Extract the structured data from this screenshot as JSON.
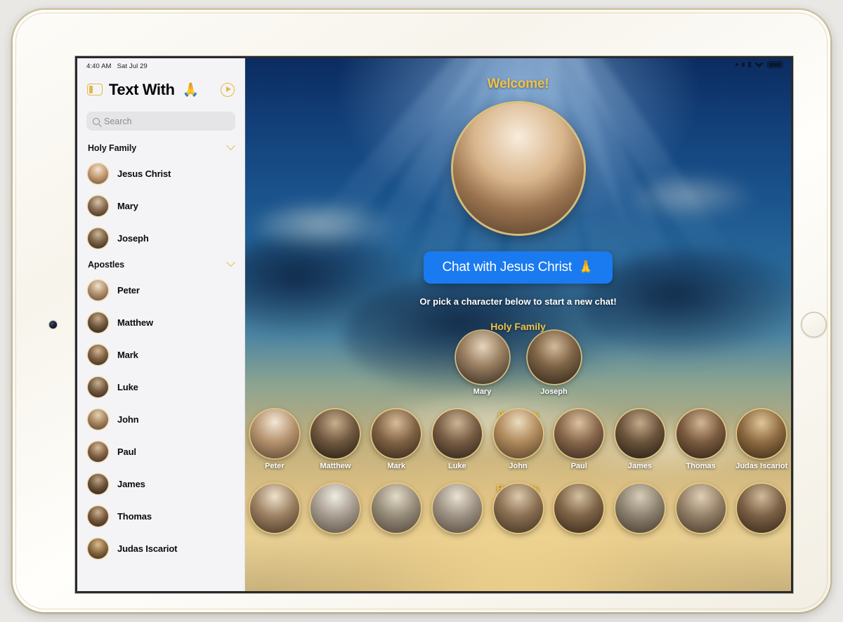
{
  "device": {
    "type": "tablet"
  },
  "status_bar": {
    "time": "4:40 AM",
    "date": "Sat Jul 29"
  },
  "sidebar": {
    "toggle_icon": "sidebar-toggle-icon",
    "title": "Text With",
    "title_emoji": "🙏",
    "history_icon": "history-play-icon",
    "search": {
      "placeholder": "Search",
      "value": ""
    },
    "groups": [
      {
        "label": "Holy Family",
        "expanded": true,
        "items": [
          {
            "name": "Jesus Christ",
            "tone1": "#f3e4d2",
            "tone2": "#9a7a5c"
          },
          {
            "name": "Mary",
            "tone1": "#d9c4a8",
            "tone2": "#3b2d22"
          },
          {
            "name": "Joseph",
            "tone1": "#cbb79a",
            "tone2": "#3a2d21"
          }
        ]
      },
      {
        "label": "Apostles",
        "expanded": true,
        "items": [
          {
            "name": "Peter",
            "tone1": "#efe3cf",
            "tone2": "#7b5c42"
          },
          {
            "name": "Matthew",
            "tone1": "#c4a98a",
            "tone2": "#2e2219"
          },
          {
            "name": "Mark",
            "tone1": "#d2b692",
            "tone2": "#4a3625"
          },
          {
            "name": "Luke",
            "tone1": "#c9b092",
            "tone2": "#3d2e22"
          },
          {
            "name": "John",
            "tone1": "#e4d3b6",
            "tone2": "#6d523a"
          },
          {
            "name": "Paul",
            "tone1": "#d6bc9a",
            "tone2": "#4d3a28"
          },
          {
            "name": "James",
            "tone1": "#bfa687",
            "tone2": "#2c2118"
          },
          {
            "name": "Thomas",
            "tone1": "#cdb191",
            "tone2": "#3b2c20"
          },
          {
            "name": "Judas Iscariot",
            "tone1": "#d9bd8f",
            "tone2": "#4a3622"
          }
        ]
      }
    ]
  },
  "main": {
    "welcome": "Welcome!",
    "hero": {
      "name": "Jesus Christ",
      "tone1": "#f6e7d4",
      "tone2": "#8d6a4c"
    },
    "chat_button": {
      "label": "Chat with Jesus Christ",
      "emoji": "🙏",
      "color": "#1a7af0"
    },
    "hint": "Or pick a character below to start a new chat!",
    "accent_color": "#f0c24a",
    "sections": [
      {
        "title": "Holy Family",
        "characters": [
          {
            "name": "Mary",
            "tone1": "#d9c4a8",
            "tone2": "#3b2d22"
          },
          {
            "name": "Joseph",
            "tone1": "#cbb79a",
            "tone2": "#3a2d21"
          }
        ]
      },
      {
        "title": "Apostles",
        "characters": [
          {
            "name": "Peter",
            "tone1": "#efe3cf",
            "tone2": "#7b5c42"
          },
          {
            "name": "Matthew",
            "tone1": "#c4a98a",
            "tone2": "#2e2219"
          },
          {
            "name": "Mark",
            "tone1": "#d2b692",
            "tone2": "#4a3625"
          },
          {
            "name": "Luke",
            "tone1": "#c9b092",
            "tone2": "#3d2e22"
          },
          {
            "name": "John",
            "tone1": "#e4d3b6",
            "tone2": "#6d523a"
          },
          {
            "name": "Paul",
            "tone1": "#d6bc9a",
            "tone2": "#4d3a28"
          },
          {
            "name": "James",
            "tone1": "#bfa687",
            "tone2": "#2c2118"
          },
          {
            "name": "Thomas",
            "tone1": "#cdb191",
            "tone2": "#3b2c20"
          },
          {
            "name": "Judas Iscariot",
            "tone1": "#d9bd8f",
            "tone2": "#4a3622"
          }
        ]
      },
      {
        "title": "Prophets",
        "characters": [
          {
            "name": "",
            "tone1": "#e6d6bb",
            "tone2": "#5a4430"
          },
          {
            "name": "",
            "tone1": "#e8e2d6",
            "tone2": "#6b6157"
          },
          {
            "name": "",
            "tone1": "#ddd2c0",
            "tone2": "#5f5346"
          },
          {
            "name": "",
            "tone1": "#e3dacb",
            "tone2": "#66594a"
          },
          {
            "name": "",
            "tone1": "#d6c3a6",
            "tone2": "#4e3b2a"
          },
          {
            "name": "",
            "tone1": "#cdb99b",
            "tone2": "#46331f"
          },
          {
            "name": "",
            "tone1": "#cfc4ae",
            "tone2": "#4f4336"
          },
          {
            "name": "",
            "tone1": "#d8c7ab",
            "tone2": "#524132"
          },
          {
            "name": "",
            "tone1": "#c9b291",
            "tone2": "#3f2f20"
          }
        ]
      }
    ]
  }
}
